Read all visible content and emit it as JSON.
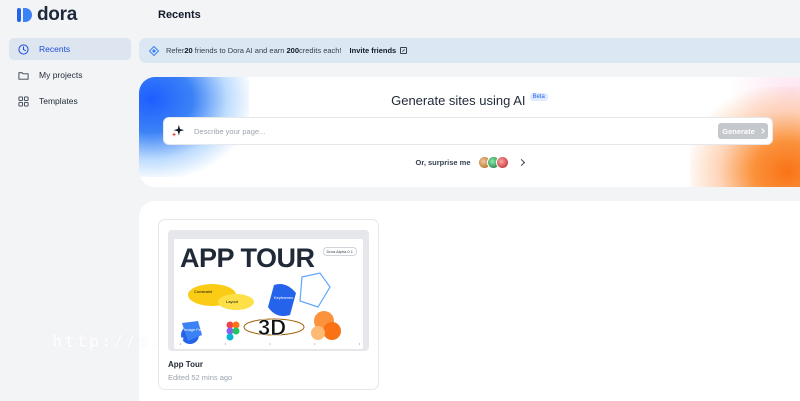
{
  "app": {
    "name": "dora"
  },
  "sidebar": {
    "items": [
      {
        "label": "Recents",
        "active": true,
        "icon": "clock-icon"
      },
      {
        "label": "My projects",
        "active": false,
        "icon": "folder-icon"
      },
      {
        "label": "Templates",
        "active": false,
        "icon": "grid-icon"
      }
    ]
  },
  "page": {
    "title": "Recents"
  },
  "referral": {
    "text_before": "Refer ",
    "friends": "20",
    "text_mid": " friends to Dora AI and earn ",
    "credits": "200",
    "text_after": " credits each!",
    "invite_label": "Invite friends"
  },
  "hero": {
    "title": "Generate sites using AI",
    "badge": "Beta",
    "placeholder": "Describe your page...",
    "generate_label": "Generate",
    "surprise_label": "Or, surprise me"
  },
  "projects": [
    {
      "name": "App Tour",
      "edited": "Edited 52 mins ago",
      "thumbnail_title": "APP TOUR",
      "thumbnail_badge": "Dora Alpha 0.1",
      "thumbnail_labels": [
        "Constraint",
        "Layout",
        "Keyframes",
        "Image Features",
        "3D"
      ]
    }
  ],
  "watermark": "http://a.  z",
  "colors": {
    "accent": "#1d4ed8",
    "referral_bg": "#dbe7f3",
    "generate_disabled": "#c4c7cc",
    "hero_left": "#3b82f6",
    "hero_right": "#f97316"
  }
}
